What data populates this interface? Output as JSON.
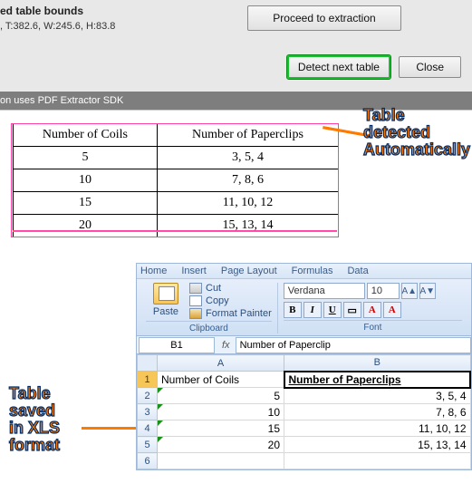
{
  "dialog": {
    "title": "ed table bounds",
    "bounds_text": ", T:382.6, W:245.6, H:83.8",
    "proceed_label": "Proceed to extraction",
    "detect_label": "Detect next table",
    "close_label": "Close"
  },
  "sdk_bar": "on uses PDF Extractor SDK",
  "callouts": {
    "detected": "Table\ndetected\nAutomatically",
    "saved": "Table\nsaved\nin XLS\nformat"
  },
  "det_table": {
    "headers": [
      "Number of Coils",
      "Number of Paperclips"
    ],
    "rows": [
      [
        "5",
        "3, 5, 4"
      ],
      [
        "10",
        "7, 8, 6"
      ],
      [
        "15",
        "11, 10, 12"
      ],
      [
        "20",
        "15, 13, 14"
      ]
    ]
  },
  "excel": {
    "tabs": [
      "Home",
      "Insert",
      "Page Layout",
      "Formulas",
      "Data"
    ],
    "paste_label": "Paste",
    "cut_label": "Cut",
    "copy_label": "Copy",
    "fp_label": "Format Painter",
    "clipboard_label": "Clipboard",
    "font_name": "Verdana",
    "font_size": "10",
    "font_label": "Font",
    "namebox": "B1",
    "fx": "fx",
    "formula": "Number of Paperclip",
    "col_headers": [
      "A",
      "B"
    ],
    "row_headers": [
      "1",
      "2",
      "3",
      "4",
      "5",
      "6"
    ],
    "cells": {
      "A1": "Number of Coils",
      "B1": "Number of Paperclips",
      "A2": "5",
      "B2": "3, 5, 4",
      "A3": "10",
      "B3": "7, 8, 6",
      "A4": "15",
      "B4": "11, 10, 12",
      "A5": "20",
      "B5": "15, 13, 14"
    }
  },
  "chart_data": {
    "type": "table",
    "title": "Number of Coils vs Number of Paperclips",
    "columns": [
      "Number of Coils",
      "Number of Paperclips"
    ],
    "rows": [
      {
        "coils": 5,
        "paperclips": [
          3,
          5,
          4
        ]
      },
      {
        "coils": 10,
        "paperclips": [
          7,
          8,
          6
        ]
      },
      {
        "coils": 15,
        "paperclips": [
          11,
          10,
          12
        ]
      },
      {
        "coils": 20,
        "paperclips": [
          15,
          13,
          14
        ]
      }
    ]
  }
}
